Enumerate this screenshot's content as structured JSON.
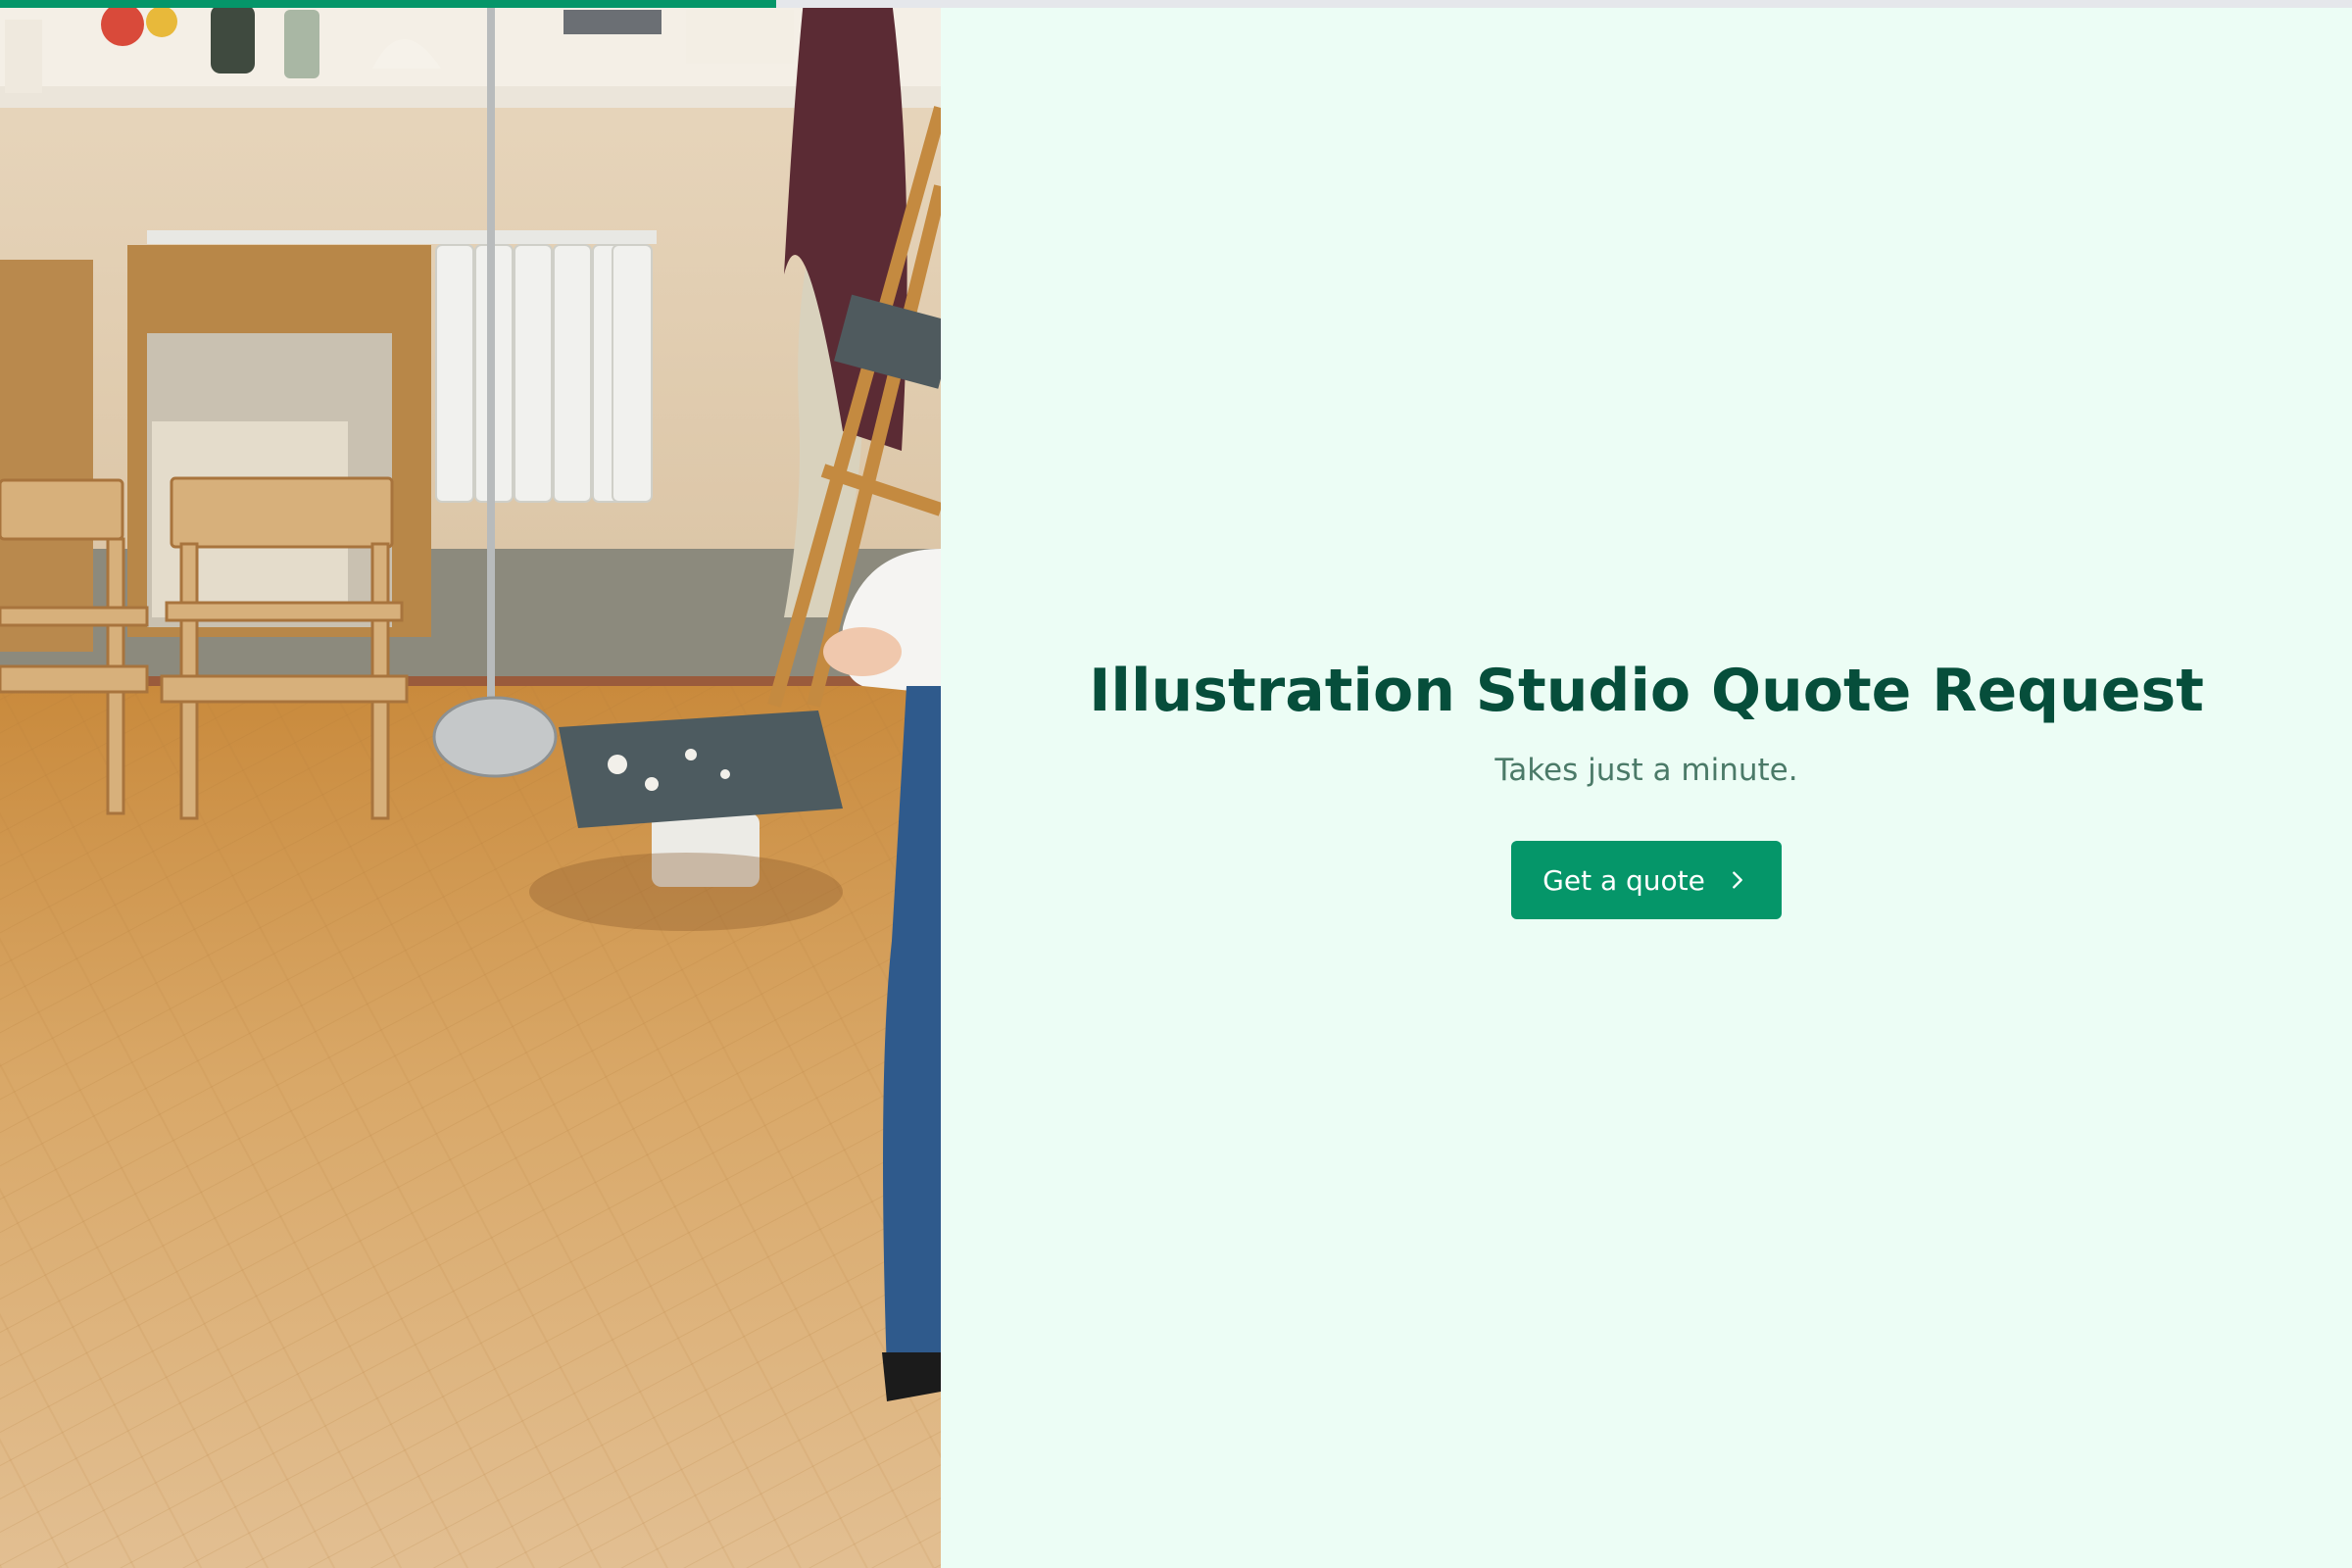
{
  "progress": {
    "percent": 33
  },
  "hero": {
    "title": "Illustration Studio Quote Request",
    "subtitle": "Takes just a minute.",
    "cta_label": "Get a quote",
    "cta_icon": "chevron-right-icon"
  },
  "theme": {
    "accent": "#059669",
    "title_color": "#064e3b",
    "background": "#ecfdf5"
  },
  "photo": {
    "subject": "art-studio-photo"
  }
}
